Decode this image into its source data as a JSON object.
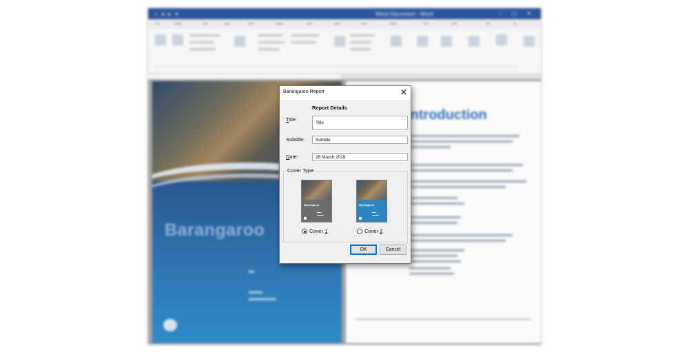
{
  "background_window": {
    "doc_title": "Word Document - Word",
    "cover_title": "Barangaroo",
    "heading": "Introduction"
  },
  "dialog": {
    "title": "Barangaroo Report",
    "close_glyph": "✕",
    "heading": "Report Details",
    "fields": {
      "title": {
        "label_accel": "T",
        "label_rest": "itle:",
        "value": "Title"
      },
      "subtitle": {
        "label": "Subtitle:",
        "value": "Subtitle"
      },
      "date": {
        "label_accel": "D",
        "label_rest": "ate:",
        "value": "28 March 2019"
      }
    },
    "cover_type": {
      "legend": "Cover Type",
      "options": [
        {
          "label_prefix": "Cover ",
          "label_accel": "1",
          "selected": true,
          "thumb_name": "Barangaroo",
          "accent": "#6d6d6d"
        },
        {
          "label_prefix": "Cover ",
          "label_accel": "2",
          "selected": false,
          "thumb_name": "Barangaroo",
          "accent": "#2e86c1"
        }
      ]
    },
    "ok_label": "OK",
    "cancel_label": "Cancel"
  }
}
